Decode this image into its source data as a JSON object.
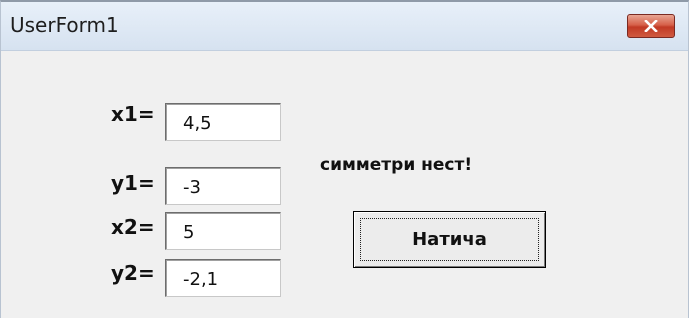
{
  "window": {
    "title": "UserForm1"
  },
  "fields": [
    {
      "label": "x1=",
      "value": "4,5"
    },
    {
      "label": "y1=",
      "value": "-3"
    },
    {
      "label": "x2=",
      "value": "5"
    },
    {
      "label": "y2=",
      "value": "-2,1"
    }
  ],
  "message": "симметри нест!",
  "button": {
    "label": "Натича"
  },
  "icons": {
    "close": "close-icon"
  }
}
